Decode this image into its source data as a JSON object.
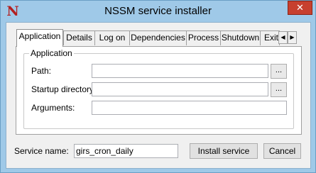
{
  "window": {
    "title": "NSSM service installer",
    "app_icon_glyph": "N",
    "close_glyph": "✕",
    "frame_color": "#9fc9e8",
    "close_color": "#c7402f"
  },
  "tabs": [
    {
      "label": "Application",
      "active": true
    },
    {
      "label": "Details",
      "active": false
    },
    {
      "label": "Log on",
      "active": false
    },
    {
      "label": "Dependencies",
      "active": false
    },
    {
      "label": "Process",
      "active": false
    },
    {
      "label": "Shutdown",
      "active": false
    },
    {
      "label": "Exit",
      "active": false
    }
  ],
  "tab_scroll": {
    "left_glyph": "◀",
    "right_glyph": "▶"
  },
  "group": {
    "title": "Application",
    "path_label": "Path:",
    "path_value": "",
    "startup_label": "Startup directory:",
    "startup_value": "",
    "arguments_label": "Arguments:",
    "arguments_value": "",
    "browse_label": "..."
  },
  "footer": {
    "service_name_label": "Service name:",
    "service_name_value": "girs_cron_daily",
    "install_label": "Install service",
    "cancel_label": "Cancel"
  }
}
